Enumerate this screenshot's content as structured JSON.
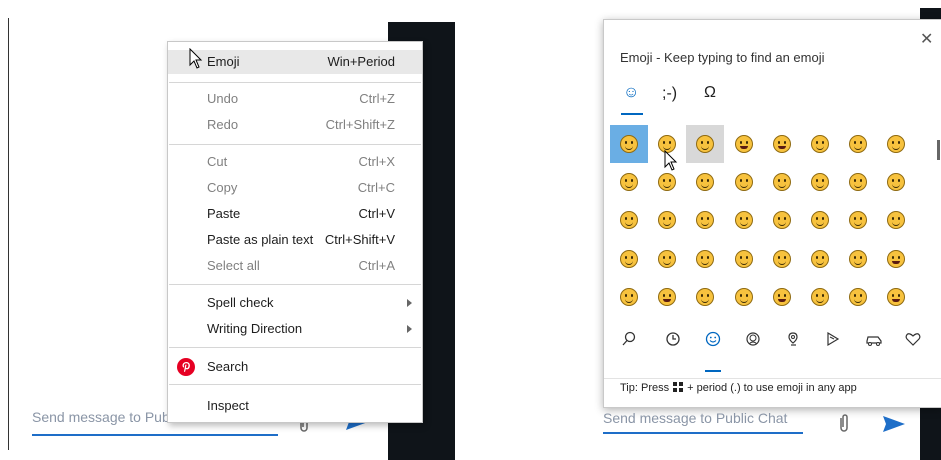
{
  "chat_left": {
    "placeholder": "Send message to Public Chat"
  },
  "context_menu": {
    "emoji": {
      "label": "Emoji",
      "shortcut": "Win+Period"
    },
    "undo": {
      "label": "Undo",
      "shortcut": "Ctrl+Z"
    },
    "redo": {
      "label": "Redo",
      "shortcut": "Ctrl+Shift+Z"
    },
    "cut": {
      "label": "Cut",
      "shortcut": "Ctrl+X"
    },
    "copy": {
      "label": "Copy",
      "shortcut": "Ctrl+C"
    },
    "paste": {
      "label": "Paste",
      "shortcut": "Ctrl+V"
    },
    "paste_plain": {
      "label": "Paste as plain text",
      "shortcut": "Ctrl+Shift+V"
    },
    "select_all": {
      "label": "Select all",
      "shortcut": "Ctrl+A"
    },
    "spell_check": {
      "label": "Spell check"
    },
    "writing_direction": {
      "label": "Writing Direction"
    },
    "search": {
      "label": "Search",
      "icon": "pinterest-icon"
    },
    "inspect": {
      "label": "Inspect"
    }
  },
  "emoji_panel": {
    "title": "Emoji - Keep typing to find an emoji",
    "tabs": [
      "☺",
      ";-)",
      "Ω"
    ],
    "category_icons": [
      "search-icon",
      "clock-icon",
      "smiley-icon",
      "person-icon",
      "location-icon",
      "party-icon",
      "car-icon",
      "heart-icon"
    ],
    "tip": {
      "prefix": "Tip: Press",
      "suffix": "+ period (.) to use emoji in any app"
    },
    "grid_rows": 5,
    "grid_cols": 8
  },
  "chat_right": {
    "placeholder": "Send message to Public Chat"
  },
  "colors": {
    "accent": "#0067c0",
    "input_underline": "#1e6ec8",
    "send": "#1e6ec8",
    "selected_emoji": "#6aaee4",
    "dark": "#0f1419"
  }
}
